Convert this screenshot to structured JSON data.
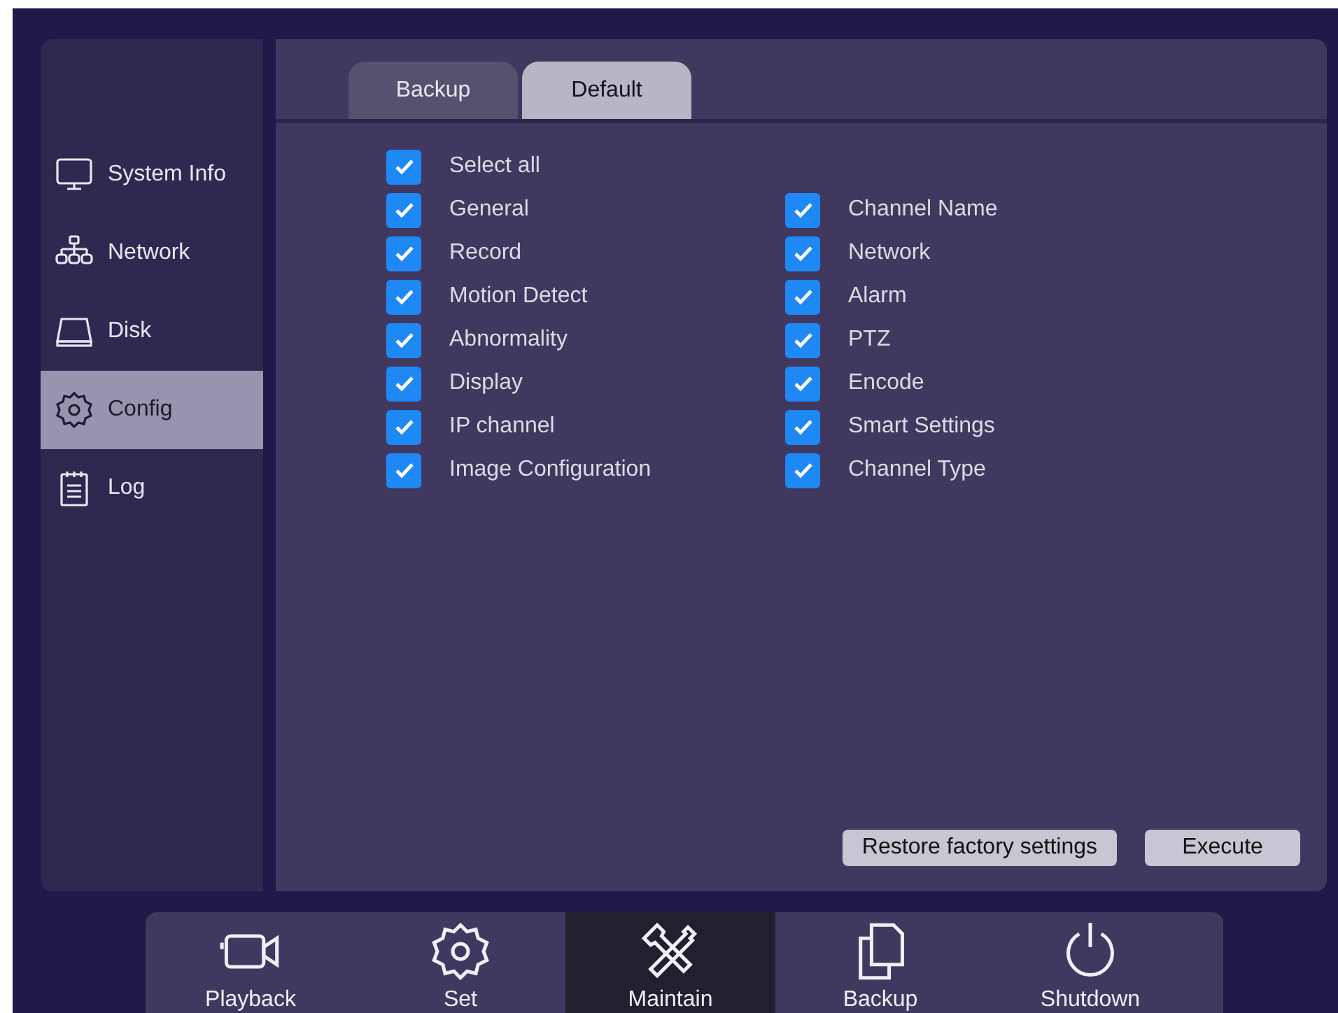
{
  "sidebar": {
    "items": [
      {
        "label": "System Info",
        "kind": "monitor",
        "selected": false
      },
      {
        "label": "Network",
        "kind": "network",
        "selected": false
      },
      {
        "label": "Disk",
        "kind": "disk",
        "selected": false
      },
      {
        "label": "Config",
        "kind": "gear",
        "selected": true
      },
      {
        "label": "Log",
        "kind": "log",
        "selected": false
      }
    ]
  },
  "tabs": [
    {
      "label": "Backup",
      "selected": false
    },
    {
      "label": "Default",
      "selected": true
    }
  ],
  "options": {
    "left": [
      {
        "label": "Select all",
        "checked": true
      },
      {
        "label": "General",
        "checked": true
      },
      {
        "label": "Record",
        "checked": true
      },
      {
        "label": "Motion Detect",
        "checked": true
      },
      {
        "label": "Abnormality",
        "checked": true
      },
      {
        "label": "Display",
        "checked": true
      },
      {
        "label": "IP channel",
        "checked": true
      },
      {
        "label": "Image Configuration",
        "checked": true
      }
    ],
    "right": [
      {
        "label": "Channel Name",
        "checked": true
      },
      {
        "label": "Network",
        "checked": true
      },
      {
        "label": "Alarm",
        "checked": true
      },
      {
        "label": "PTZ",
        "checked": true
      },
      {
        "label": "Encode",
        "checked": true
      },
      {
        "label": "Smart Settings",
        "checked": true
      },
      {
        "label": "Channel Type",
        "checked": true
      }
    ]
  },
  "buttons": [
    "Restore factory settings",
    "Execute"
  ],
  "bottom_nav": [
    {
      "label": "Playback",
      "kind": "camera",
      "selected": false
    },
    {
      "label": "Set",
      "kind": "gear",
      "selected": false
    },
    {
      "label": "Maintain",
      "kind": "tools",
      "selected": true
    },
    {
      "label": "Backup",
      "kind": "files",
      "selected": false
    },
    {
      "label": "Shutdown",
      "kind": "power",
      "selected": false
    }
  ]
}
